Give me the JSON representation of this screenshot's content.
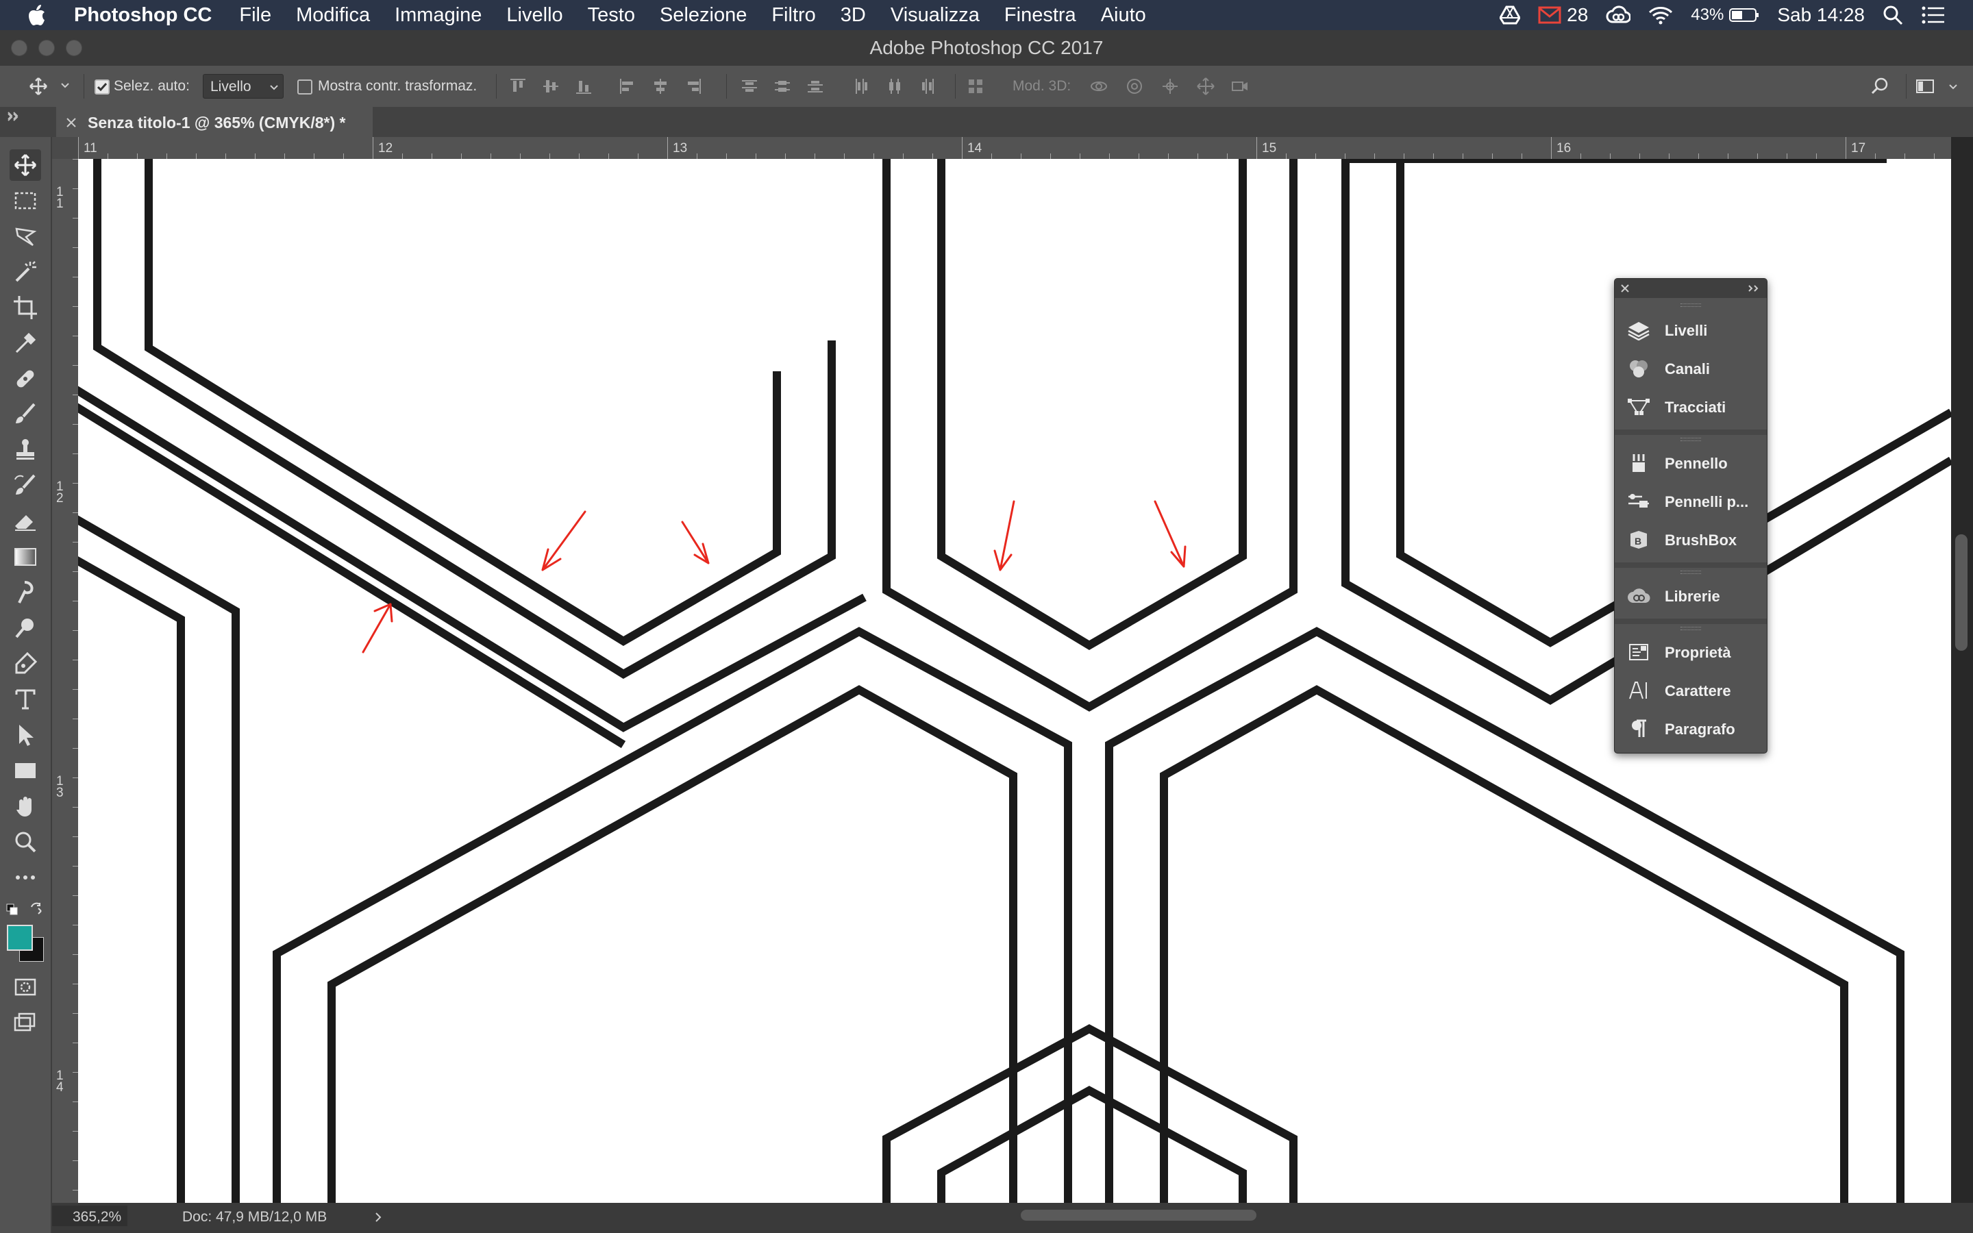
{
  "menubar": {
    "app_name": "Photoshop CC",
    "items": [
      "File",
      "Modifica",
      "Immagine",
      "Livello",
      "Testo",
      "Selezione",
      "Filtro",
      "3D",
      "Visualizza",
      "Finestra",
      "Aiuto"
    ],
    "mail_count": "28",
    "battery": "43%",
    "clock": "Sab 14:28"
  },
  "window": {
    "title": "Adobe Photoshop CC 2017"
  },
  "options": {
    "auto_select_label": "Selez. auto:",
    "auto_select_value": "Livello",
    "show_transform_label": "Mostra contr. trasformaz.",
    "mode3d_label": "Mod. 3D:"
  },
  "document": {
    "tab_title": "Senza titolo-1 @ 365% (CMYK/8*) *"
  },
  "rulers": {
    "top": [
      "11",
      "12",
      "13",
      "14",
      "15",
      "16",
      "17"
    ],
    "left": [
      "1\n1",
      "1\n2",
      "1\n3",
      "1\n4"
    ]
  },
  "panel": {
    "groups": [
      [
        "Livelli",
        "Canali",
        "Tracciati"
      ],
      [
        "Pennello",
        "Pennelli p...",
        "BrushBox"
      ],
      [
        "Librerie"
      ],
      [
        "Proprietà",
        "Carattere",
        "Paragrafo"
      ]
    ]
  },
  "status": {
    "zoom": "365,2%",
    "doc_size": "Doc: 47,9 MB/12,0 MB"
  },
  "colors": {
    "foreground": "#1aa39a",
    "background": "#111111",
    "annotation": "#e8281e"
  }
}
